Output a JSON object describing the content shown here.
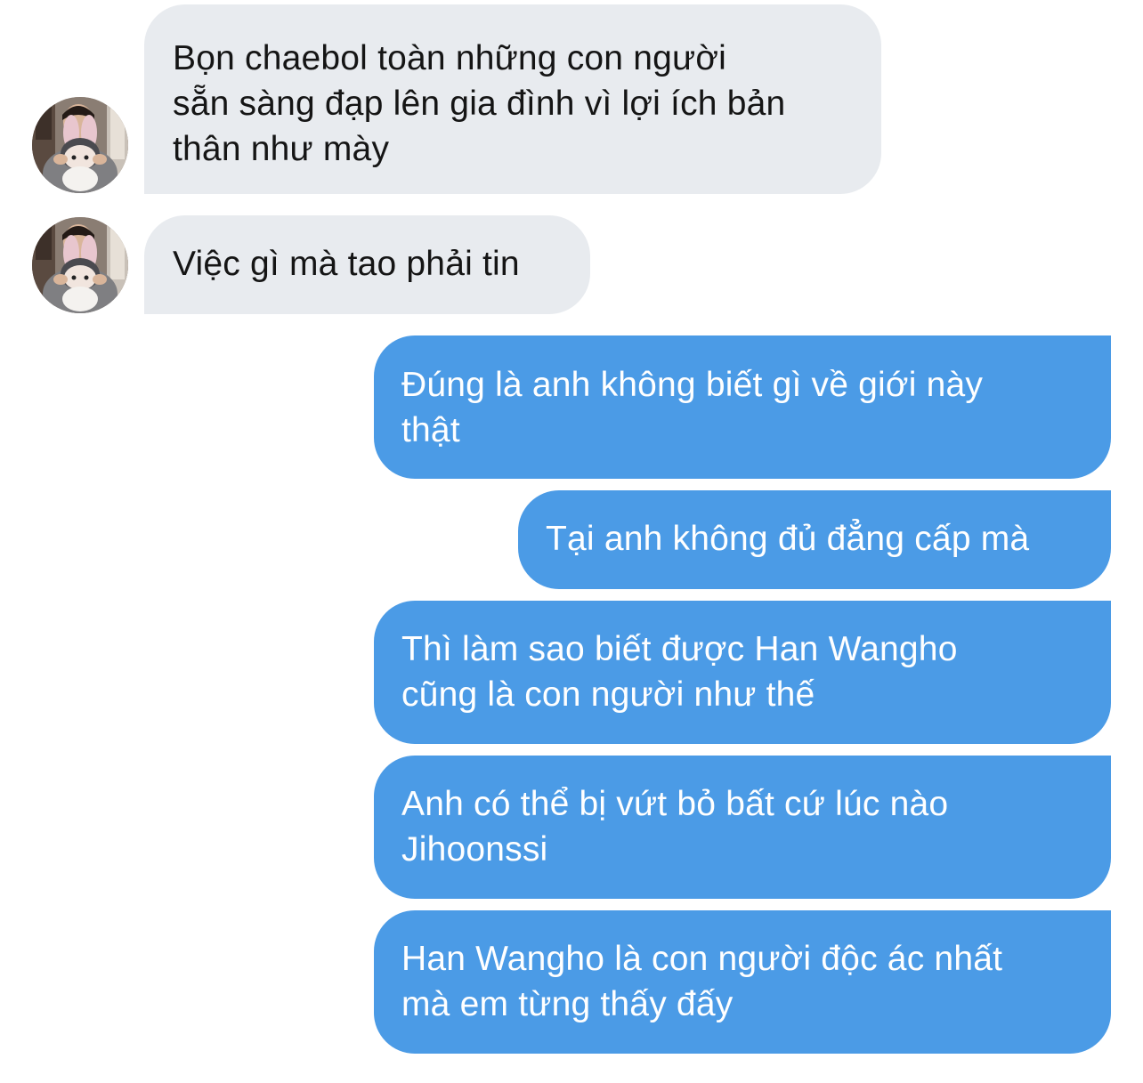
{
  "conversation": {
    "messages": [
      {
        "direction": "incoming",
        "show_avatar": true,
        "lines": [
          "Bọn chaebol toàn những con người",
          "sẵn sàng đạp lên gia đình vì lợi ích bản",
          "thân như mày"
        ]
      },
      {
        "direction": "incoming",
        "show_avatar": true,
        "lines": [
          "Việc gì mà tao phải tin"
        ]
      },
      {
        "direction": "outgoing",
        "lines": [
          "Đúng là anh không biết gì về giới này",
          "thật"
        ]
      },
      {
        "direction": "outgoing",
        "lines": [
          "Tại anh không đủ đẳng cấp mà"
        ]
      },
      {
        "direction": "outgoing",
        "lines": [
          "Thì làm sao biết được Han Wangho",
          "cũng là con người như thế"
        ]
      },
      {
        "direction": "outgoing",
        "lines": [
          "Anh có thể bị vứt bỏ bất cứ lúc nào",
          "Jihoonssi"
        ]
      },
      {
        "direction": "outgoing",
        "lines": [
          "Han Wangho là con người độc ác nhất",
          "mà em từng thấy đấy"
        ]
      }
    ]
  },
  "colors": {
    "incoming_bubble": "#e8ebef",
    "incoming_text": "#151515",
    "outgoing_bubble": "#4b9be6",
    "outgoing_text": "#ffffff"
  },
  "icons": {
    "avatar": "avatar-photo-icon"
  }
}
